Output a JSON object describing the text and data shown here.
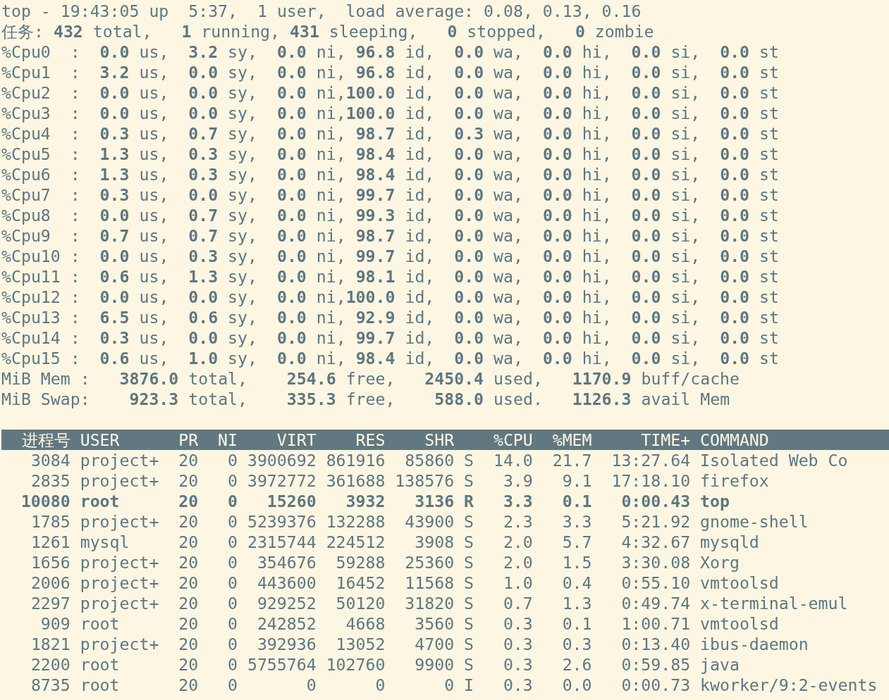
{
  "summary_lines": [
    "top - 19:43:05 up  5:37,  1 user,  load average: 0.08, 0.13, 0.16",
    "任务: **432** total,   **1** running, **431** sleeping,   **0** stopped,   **0** zombie",
    "%Cpu0  :  **0.0** us,  **3.2** sy,  **0.0** ni, **96.8** id,  **0.0** wa,  **0.0** hi,  **0.0** si,  **0.0** st",
    "%Cpu1  :  **3.2** us,  **0.0** sy,  **0.0** ni, **96.8** id,  **0.0** wa,  **0.0** hi,  **0.0** si,  **0.0** st",
    "%Cpu2  :  **0.0** us,  **0.0** sy,  **0.0** ni,**100.0** id,  **0.0** wa,  **0.0** hi,  **0.0** si,  **0.0** st",
    "%Cpu3  :  **0.0** us,  **0.0** sy,  **0.0** ni,**100.0** id,  **0.0** wa,  **0.0** hi,  **0.0** si,  **0.0** st",
    "%Cpu4  :  **0.3** us,  **0.7** sy,  **0.0** ni, **98.7** id,  **0.3** wa,  **0.0** hi,  **0.0** si,  **0.0** st",
    "%Cpu5  :  **1.3** us,  **0.3** sy,  **0.0** ni, **98.4** id,  **0.0** wa,  **0.0** hi,  **0.0** si,  **0.0** st",
    "%Cpu6  :  **1.3** us,  **0.3** sy,  **0.0** ni, **98.4** id,  **0.0** wa,  **0.0** hi,  **0.0** si,  **0.0** st",
    "%Cpu7  :  **0.3** us,  **0.0** sy,  **0.0** ni, **99.7** id,  **0.0** wa,  **0.0** hi,  **0.0** si,  **0.0** st",
    "%Cpu8  :  **0.0** us,  **0.7** sy,  **0.0** ni, **99.3** id,  **0.0** wa,  **0.0** hi,  **0.0** si,  **0.0** st",
    "%Cpu9  :  **0.7** us,  **0.7** sy,  **0.0** ni, **98.7** id,  **0.0** wa,  **0.0** hi,  **0.0** si,  **0.0** st",
    "%Cpu10 :  **0.0** us,  **0.3** sy,  **0.0** ni, **99.7** id,  **0.0** wa,  **0.0** hi,  **0.0** si,  **0.0** st",
    "%Cpu11 :  **0.6** us,  **1.3** sy,  **0.0** ni, **98.1** id,  **0.0** wa,  **0.0** hi,  **0.0** si,  **0.0** st",
    "%Cpu12 :  **0.0** us,  **0.0** sy,  **0.0** ni,**100.0** id,  **0.0** wa,  **0.0** hi,  **0.0** si,  **0.0** st",
    "%Cpu13 :  **6.5** us,  **0.6** sy,  **0.0** ni, **92.9** id,  **0.0** wa,  **0.0** hi,  **0.0** si,  **0.0** st",
    "%Cpu14 :  **0.3** us,  **0.0** sy,  **0.0** ni, **99.7** id,  **0.0** wa,  **0.0** hi,  **0.0** si,  **0.0** st",
    "%Cpu15 :  **0.6** us,  **1.0** sy,  **0.0** ni, **98.4** id,  **0.0** wa,  **0.0** hi,  **0.0** si,  **0.0** st",
    "MiB Mem :   **3876.0** total,    **254.6** free,   **2450.4** used,   **1170.9** buff/cache",
    "MiB Swap:    **923.3** total,    **335.3** free,    **588.0** used.   **1126.3** avail Mem"
  ],
  "process_table": {
    "columns": [
      "进程号",
      "USER",
      "PR",
      "NI",
      "VIRT",
      "RES",
      "SHR",
      "",
      "%CPU",
      "%MEM",
      "TIME+",
      "COMMAND"
    ],
    "rows": [
      {
        "highlighted": false,
        "cells": [
          "3084",
          "project+",
          "20",
          "0",
          "3900692",
          "861916",
          "85860",
          "S",
          "14.0",
          "21.7",
          "13:27.64",
          "Isolated Web Co"
        ]
      },
      {
        "highlighted": false,
        "cells": [
          "2835",
          "project+",
          "20",
          "0",
          "3972772",
          "361688",
          "138576",
          "S",
          "3.9",
          "9.1",
          "17:18.10",
          "firefox"
        ]
      },
      {
        "highlighted": true,
        "cells": [
          "10080",
          "root",
          "20",
          "0",
          "15260",
          "3932",
          "3136",
          "R",
          "3.3",
          "0.1",
          "0:00.43",
          "top"
        ]
      },
      {
        "highlighted": false,
        "cells": [
          "1785",
          "project+",
          "20",
          "0",
          "5239376",
          "132288",
          "43900",
          "S",
          "2.3",
          "3.3",
          "5:21.92",
          "gnome-shell"
        ]
      },
      {
        "highlighted": false,
        "cells": [
          "1261",
          "mysql",
          "20",
          "0",
          "2315744",
          "224512",
          "3908",
          "S",
          "2.0",
          "5.7",
          "4:32.67",
          "mysqld"
        ]
      },
      {
        "highlighted": false,
        "cells": [
          "1656",
          "project+",
          "20",
          "0",
          "354676",
          "59288",
          "25360",
          "S",
          "2.0",
          "1.5",
          "3:30.08",
          "Xorg"
        ]
      },
      {
        "highlighted": false,
        "cells": [
          "2006",
          "project+",
          "20",
          "0",
          "443600",
          "16452",
          "11568",
          "S",
          "1.0",
          "0.4",
          "0:55.10",
          "vmtoolsd"
        ]
      },
      {
        "highlighted": false,
        "cells": [
          "2297",
          "project+",
          "20",
          "0",
          "929252",
          "50120",
          "31820",
          "S",
          "0.7",
          "1.3",
          "0:49.74",
          "x-terminal-emul"
        ]
      },
      {
        "highlighted": false,
        "cells": [
          "909",
          "root",
          "20",
          "0",
          "242852",
          "4668",
          "3560",
          "S",
          "0.3",
          "0.1",
          "1:00.71",
          "vmtoolsd"
        ]
      },
      {
        "highlighted": false,
        "cells": [
          "1821",
          "project+",
          "20",
          "0",
          "392936",
          "13052",
          "4700",
          "S",
          "0.3",
          "0.3",
          "0:13.40",
          "ibus-daemon"
        ]
      },
      {
        "highlighted": false,
        "cells": [
          "2200",
          "root",
          "20",
          "0",
          "5755764",
          "102760",
          "9900",
          "S",
          "0.3",
          "2.6",
          "0:59.85",
          "java"
        ]
      },
      {
        "highlighted": false,
        "cells": [
          "8735",
          "root",
          "20",
          "0",
          "0",
          "0",
          "0",
          "I",
          "0.3",
          "0.0",
          "0:00.73",
          "kworker/9:2-events"
        ]
      }
    ]
  }
}
